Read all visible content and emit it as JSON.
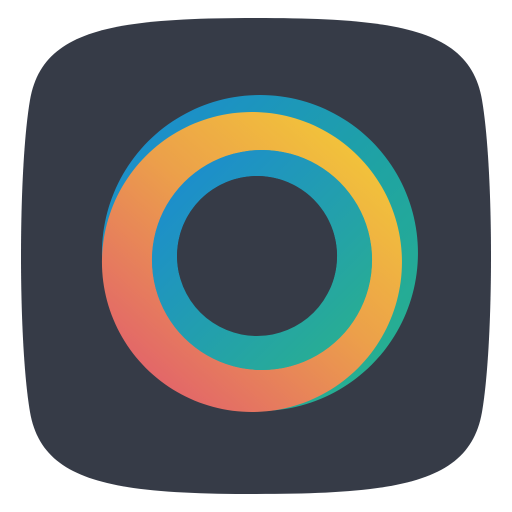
{
  "icon": {
    "name": "app-icon",
    "background_color": "#363b47",
    "colors": {
      "blue": "#1a88d6",
      "teal": "#1fa3a3",
      "green": "#2ab38a",
      "yellow": "#f2c43a",
      "orange": "#eca04a",
      "coral": "#e46c5e",
      "pink": "#e2646a"
    }
  }
}
